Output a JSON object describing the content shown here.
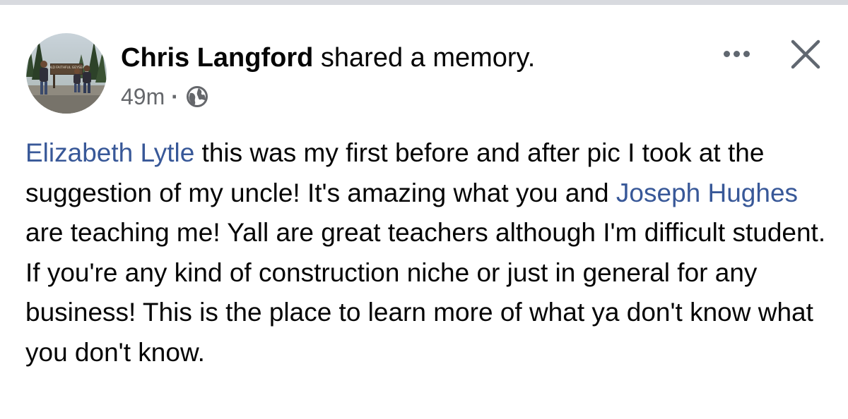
{
  "post": {
    "author": "Chris Langford",
    "action": "shared a memory.",
    "timestamp": "49m",
    "separator": "·",
    "privacy_icon": "globe-icon",
    "avatar_sign_text": "OLD FAITHFUL GEYSER",
    "more_icon": "more-dots-icon",
    "close_icon": "close-icon",
    "body": [
      {
        "type": "mention",
        "text": "Elizabeth Lytle"
      },
      {
        "type": "text",
        "text": " this was my first before and after pic I took at the suggestion of my uncle! It's amazing what you and "
      },
      {
        "type": "mention",
        "text": "Joseph Hughes"
      },
      {
        "type": "text",
        "text": " are teaching me! Yall are great teachers although I'm difficult student. If you're any kind of construction niche or just in general for any business! This is the place to learn more of what ya don't know what you don't know."
      }
    ]
  },
  "colors": {
    "text": "#050505",
    "secondary_text": "#65676b",
    "mention_link": "#385898",
    "icon_gray": "#606770",
    "top_strip": "#d8dadf"
  }
}
